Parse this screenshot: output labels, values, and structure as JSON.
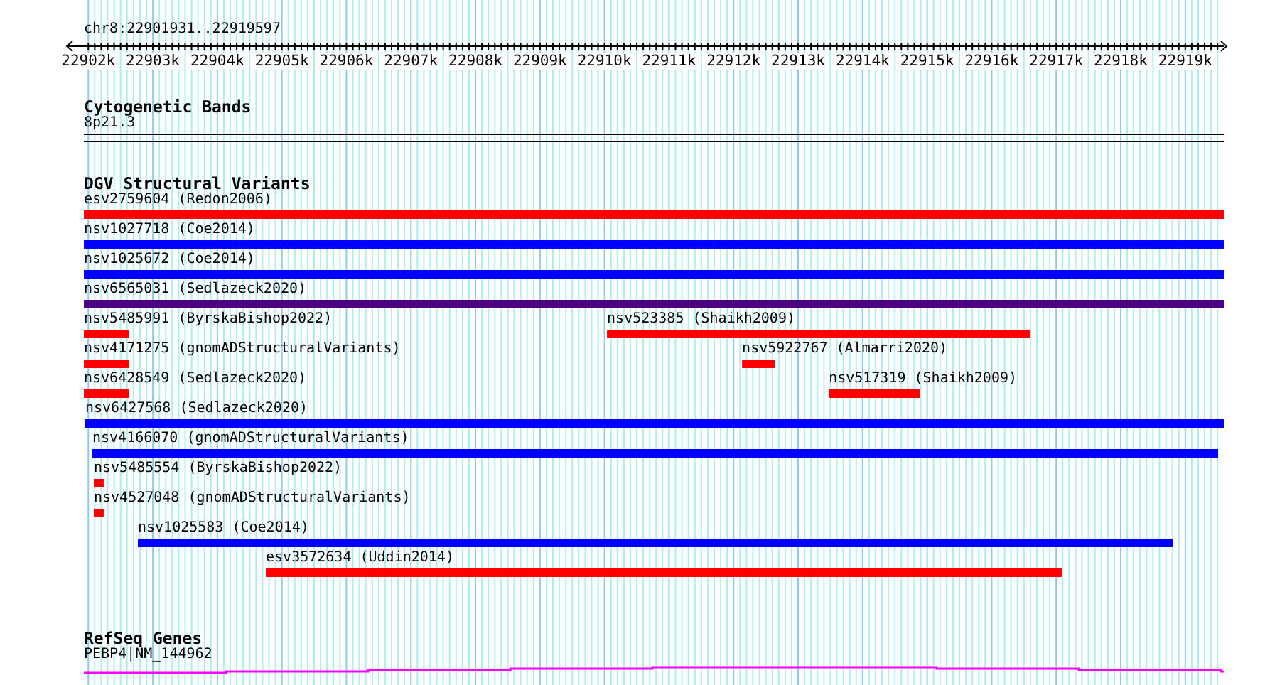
{
  "location": "chr8:22901931..22919597",
  "ruler": {
    "ticks": [
      "22902k",
      "22903k",
      "22904k",
      "22905k",
      "22906k",
      "22907k",
      "22908k",
      "22909k",
      "22910k",
      "22911k",
      "22912k",
      "22913k",
      "22914k",
      "22915k",
      "22916k",
      "22917k",
      "22918k",
      "22919k"
    ]
  },
  "tracks": [
    {
      "kind": "bands",
      "title": "Cytogenetic Bands",
      "band": {
        "label": "8p21.3"
      }
    },
    {
      "kind": "variants",
      "title": "DGV Structural Variants",
      "rows": [
        {
          "features": [
            {
              "label": "esv2759604 (Redon2006)",
              "color": "#ff0000"
            }
          ]
        },
        {
          "features": [
            {
              "label": "nsv1027718 (Coe2014)",
              "color": "#0000ff"
            }
          ]
        },
        {
          "features": [
            {
              "label": "nsv1025672 (Coe2014)",
              "color": "#0000ff"
            }
          ]
        },
        {
          "features": [
            {
              "label": "nsv6565031 (Sedlazeck2020)",
              "color": "#4b0082"
            }
          ]
        },
        {
          "features": [
            {
              "label": "nsv5485991 (ByrskaBishop2022)",
              "color": "#ff0000"
            },
            {
              "label": "nsv523385 (Shaikh2009)",
              "color": "#ff0000"
            }
          ]
        },
        {
          "features": [
            {
              "label": "nsv4171275 (gnomADStructuralVariants)",
              "color": "#ff0000"
            },
            {
              "label": "nsv5922767 (Almarri2020)",
              "color": "#ff0000"
            }
          ]
        },
        {
          "features": [
            {
              "label": "nsv6428549 (Sedlazeck2020)",
              "color": "#ff0000"
            },
            {
              "label": "nsv517319 (Shaikh2009)",
              "color": "#ff0000"
            }
          ]
        },
        {
          "features": [
            {
              "label": "nsv6427568 (Sedlazeck2020)",
              "color": "#0000ff"
            }
          ]
        },
        {
          "features": [
            {
              "label": "nsv4166070 (gnomADStructuralVariants)",
              "color": "#0000ff"
            }
          ]
        },
        {
          "features": [
            {
              "label": "nsv5485554 (ByrskaBishop2022)",
              "color": "#ff0000"
            }
          ]
        },
        {
          "features": [
            {
              "label": "nsv4527048 (gnomADStructuralVariants)",
              "color": "#ff0000"
            }
          ]
        },
        {
          "features": [
            {
              "label": "nsv1025583 (Coe2014)",
              "color": "#0000ff"
            }
          ]
        },
        {
          "features": [
            {
              "label": "esv3572634 (Uddin2014)",
              "color": "#ff0000"
            }
          ]
        }
      ]
    },
    {
      "kind": "genes",
      "title": "RefSeq Genes",
      "gene": {
        "label": "PEBP4|NM_144962"
      }
    }
  ]
}
